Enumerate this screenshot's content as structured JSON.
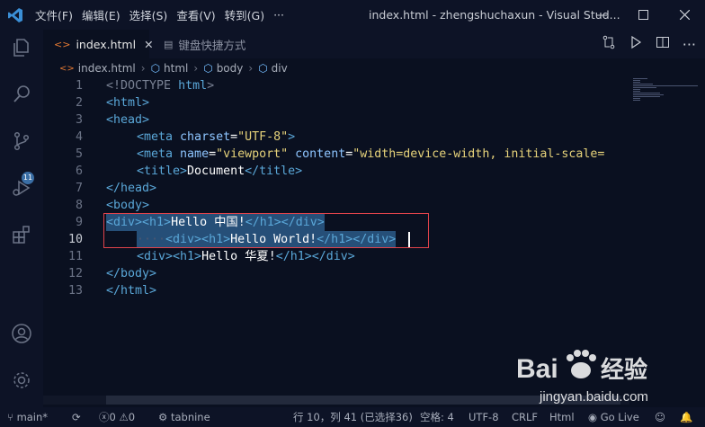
{
  "titlebar": {
    "menu": [
      "文件(F)",
      "编辑(E)",
      "选择(S)",
      "查看(V)",
      "转到(G)",
      "···"
    ],
    "title": "index.html - zhengshuchaxun - Visual Stud...",
    "icons": {
      "minimize": "minimize-icon",
      "maximize": "maximize-icon",
      "close": "close-icon"
    }
  },
  "activity": {
    "source_control_badge": "11"
  },
  "tabs": [
    {
      "label": "index.html",
      "active": true
    },
    {
      "label": "键盘快捷方式",
      "active": false
    }
  ],
  "breadcrumb": [
    "index.html",
    "html",
    "body",
    "div"
  ],
  "editor": {
    "current_line": 10,
    "lines": [
      {
        "n": "1"
      },
      {
        "n": "2"
      },
      {
        "n": "3"
      },
      {
        "n": "4"
      },
      {
        "n": "5"
      },
      {
        "n": "6"
      },
      {
        "n": "7"
      },
      {
        "n": "8"
      },
      {
        "n": "9"
      },
      {
        "n": "10"
      },
      {
        "n": "11"
      },
      {
        "n": "12"
      },
      {
        "n": "13"
      }
    ],
    "text": {
      "l1_doctype": "<!DOCTYPE ",
      "l1_html": "html",
      "l1_end": ">",
      "l2": "<html>",
      "l3": "<head>",
      "l4_open": "<meta ",
      "l4_attr": "charset",
      "l4_eq": "=",
      "l4_val": "\"UTF-8\"",
      "l4_end": ">",
      "l5_open": "<meta ",
      "l5_attr1": "name",
      "l5_val1": "\"viewport\"",
      "l5_attr2": " content",
      "l5_val2": "\"width=device-width, initial-scale=",
      "l6_open": "<title>",
      "l6_text": "Document",
      "l6_close": "</title>",
      "l7": "</head>",
      "l8": "<body>",
      "l9_tags_a": "<div><h1>",
      "l9_text": "Hello 中国!",
      "l9_tags_b": "</h1></div>",
      "l10_dots": "····",
      "l10_tags_a": "<div><h1>",
      "l10_text": "Hello World!",
      "l10_tags_b": "</h1></div>",
      "l11_tags_a": "<div><h1>",
      "l11_text": "Hello 华夏!",
      "l11_tags_b": "</h1></div>",
      "l12": "</body>",
      "l13": "</html>"
    }
  },
  "statusbar": {
    "branch": "main*",
    "errors": "0",
    "warnings": "0",
    "tabnine": "tabnine",
    "position": "行 10，列 41 (已选择36)",
    "spaces": "空格: 4",
    "encoding": "UTF-8",
    "eol": "CRLF",
    "language": "Html",
    "golive": "Go Live"
  },
  "watermark": {
    "brand": "Bai",
    "brand2": "经验",
    "url": "jingyan.baidu.com"
  },
  "colors": {
    "background": "#0a1020",
    "chrome": "#0d1326",
    "tag": "#5aa7d8",
    "string": "#e6d27a",
    "selection": "#264f78",
    "highlight_box": "#e0434b"
  }
}
